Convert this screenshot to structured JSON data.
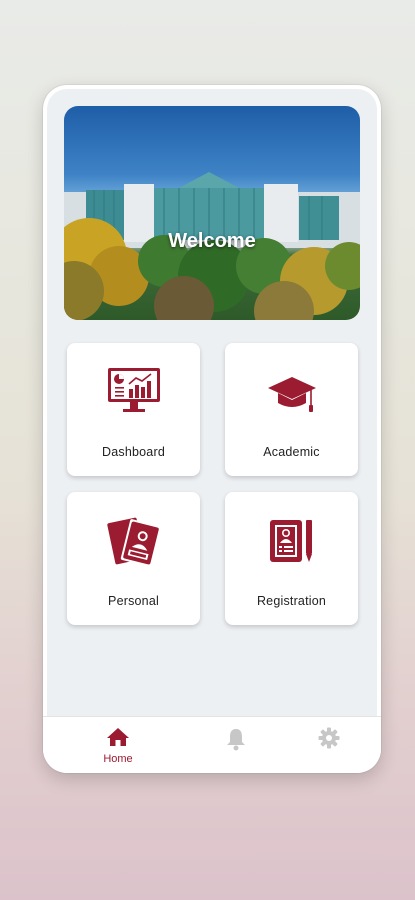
{
  "colors": {
    "accent": "#9b1b30",
    "inactive_icon": "#c7c7c7",
    "screen_bg": "#edf0f3"
  },
  "hero": {
    "title": "Welcome"
  },
  "tiles": [
    {
      "label": "Dashboard",
      "icon": "dashboard-monitor-chart-icon"
    },
    {
      "label": "Academic",
      "icon": "graduation-cap-icon"
    },
    {
      "label": "Personal",
      "icon": "personal-id-cards-icon"
    },
    {
      "label": "Registration",
      "icon": "registration-form-pen-icon"
    }
  ],
  "bottom_nav": [
    {
      "label": "Home",
      "icon": "home-icon",
      "active": true
    },
    {
      "label": "",
      "icon": "bell-icon",
      "active": false
    },
    {
      "label": "",
      "icon": "gear-icon",
      "active": false
    }
  ]
}
